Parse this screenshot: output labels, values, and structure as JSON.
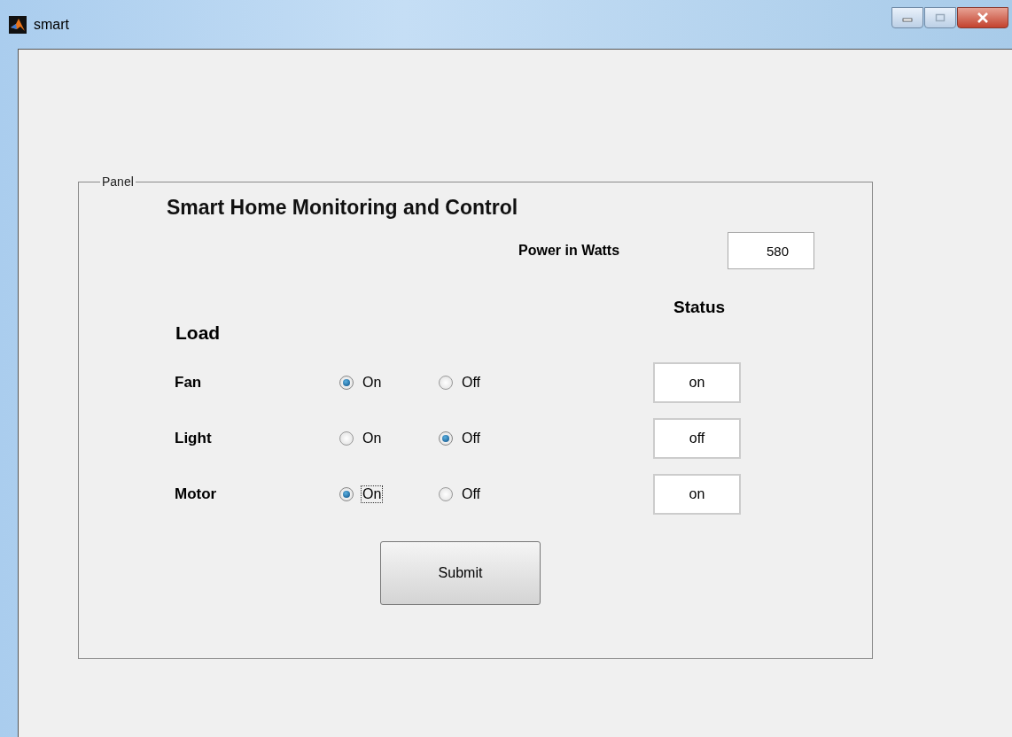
{
  "window": {
    "title": "smart"
  },
  "panel": {
    "label": "Panel",
    "heading": "Smart Home Monitoring and Control",
    "power": {
      "label": "Power in Watts",
      "value": "580"
    },
    "status_heading": "Status",
    "load_heading": "Load",
    "loads": [
      {
        "name": "Fan",
        "options": [
          {
            "label": "On",
            "selected": true,
            "focused": false
          },
          {
            "label": "Off",
            "selected": false,
            "focused": false
          }
        ],
        "status": "on"
      },
      {
        "name": "Light",
        "options": [
          {
            "label": "On",
            "selected": false,
            "focused": false
          },
          {
            "label": "Off",
            "selected": true,
            "focused": false
          }
        ],
        "status": "off"
      },
      {
        "name": "Motor",
        "options": [
          {
            "label": "On",
            "selected": true,
            "focused": true
          },
          {
            "label": "Off",
            "selected": false,
            "focused": false
          }
        ],
        "status": "on"
      }
    ],
    "submit": "Submit"
  }
}
